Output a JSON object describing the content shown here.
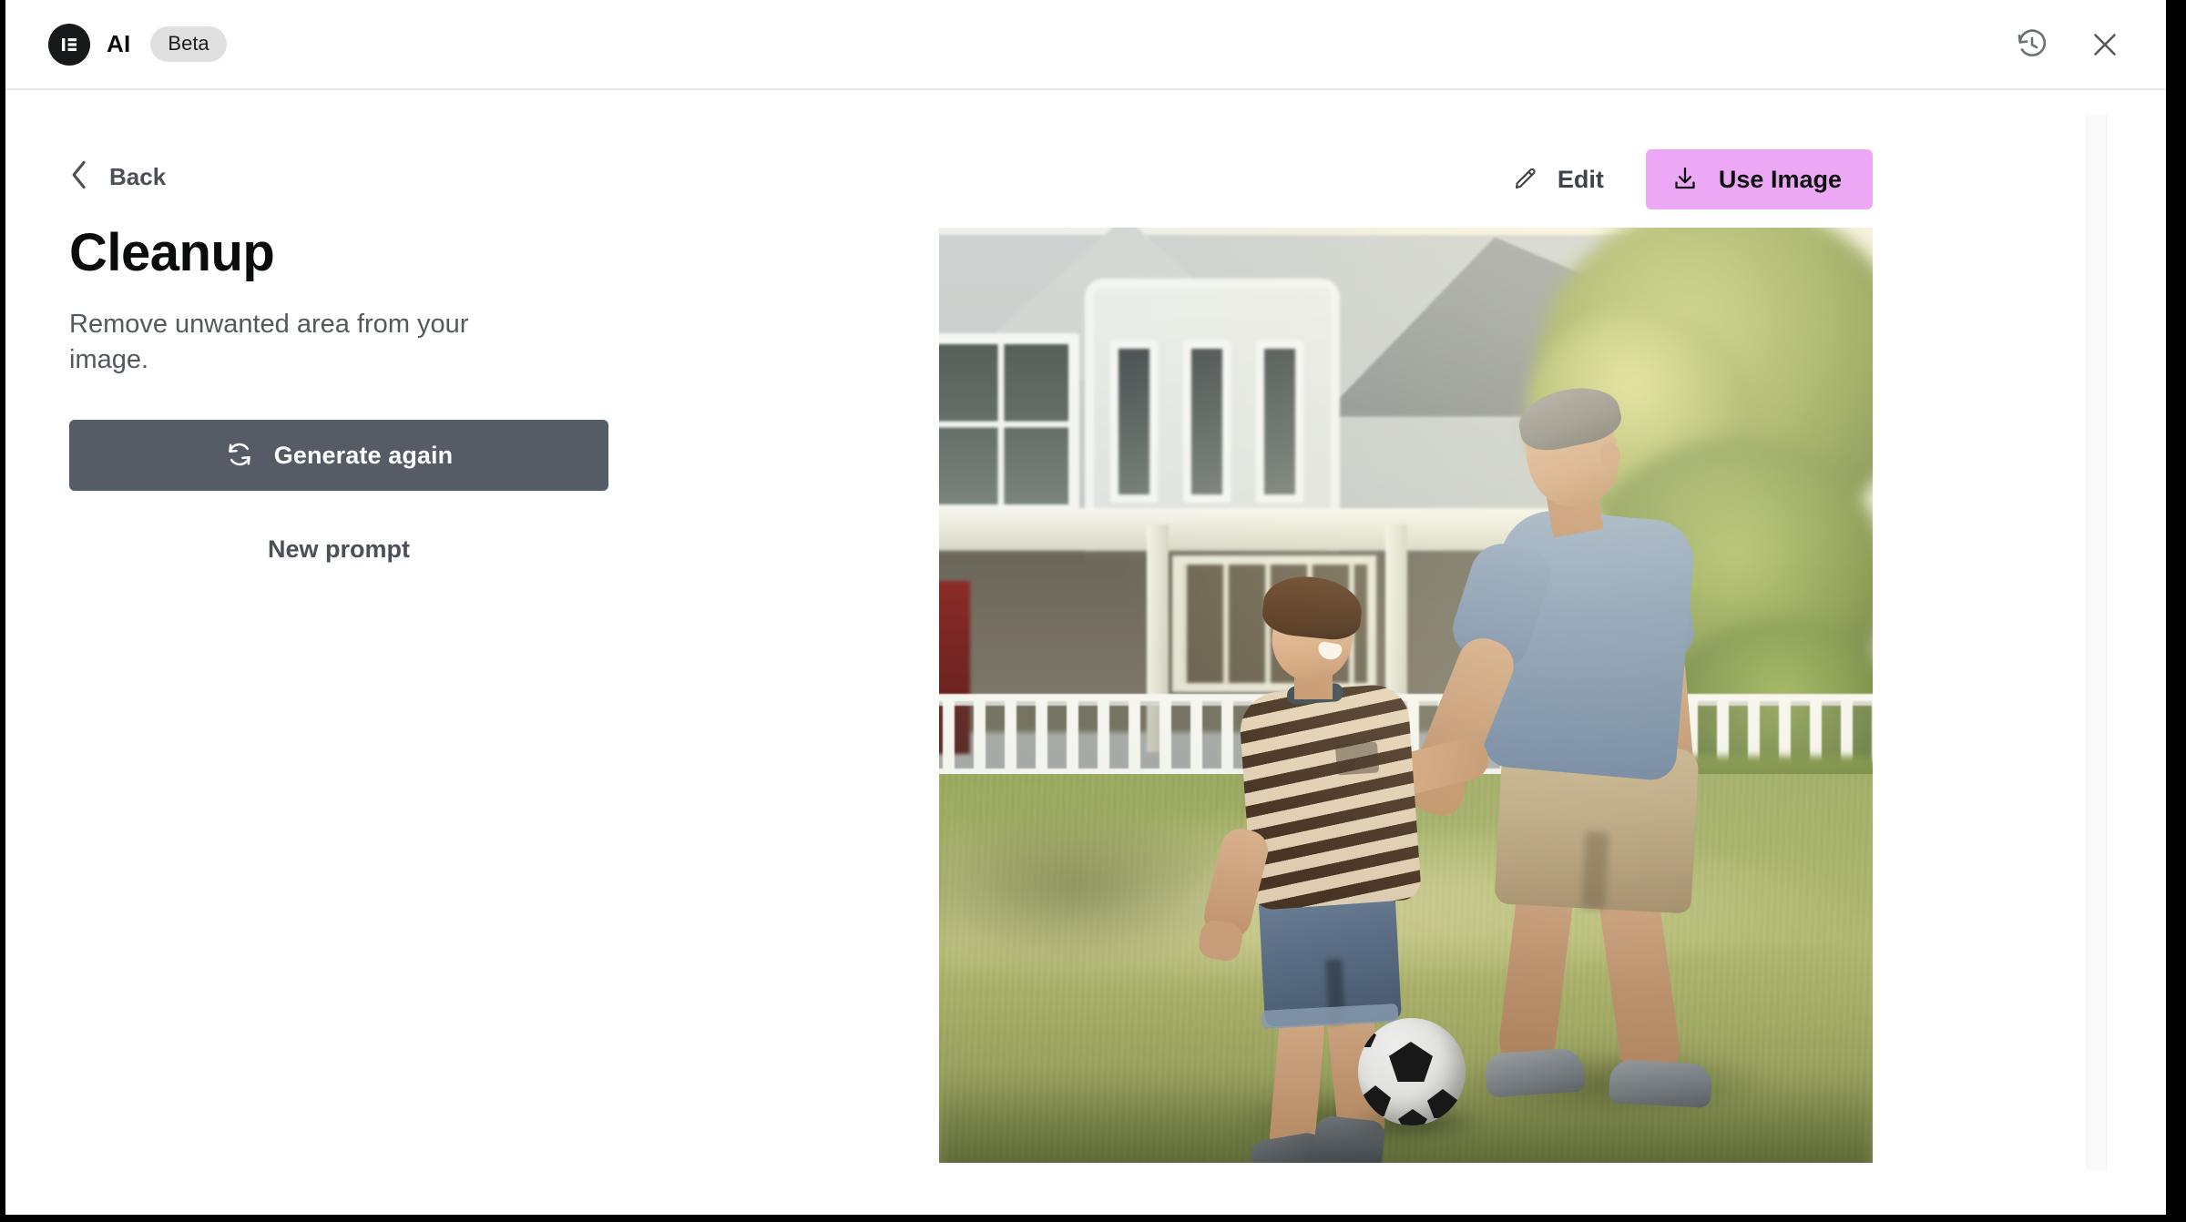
{
  "header": {
    "logo_icon": "elementor-logo-icon",
    "brand": "AI",
    "badge": "Beta",
    "history_icon": "history-clock-icon",
    "close_icon": "close-icon"
  },
  "left_panel": {
    "back_icon": "chevron-left-icon",
    "back_label": "Back",
    "title": "Cleanup",
    "subtitle": "Remove unwanted area from your image.",
    "generate_again": {
      "label": "Generate again",
      "icon": "refresh-icon",
      "background": "#565C66",
      "text_color": "#FFFFFF"
    },
    "new_prompt_label": "New prompt"
  },
  "preview": {
    "edit": {
      "label": "Edit",
      "icon": "pencil-icon"
    },
    "use_image": {
      "label": "Use Image",
      "icon": "download-icon",
      "background": "#EDA8F5",
      "text_color": "#0E0F10"
    },
    "image_alt": "Father and son playing soccer on a sunlit lawn in front of a white suburban house"
  },
  "colors": {
    "accent_pink": "#EDA8F5",
    "slate_button": "#565C66",
    "text_primary": "#0B0C0D",
    "text_secondary": "#53585F",
    "badge_bg": "#E0E0E0",
    "border": "#E6E8EA"
  }
}
